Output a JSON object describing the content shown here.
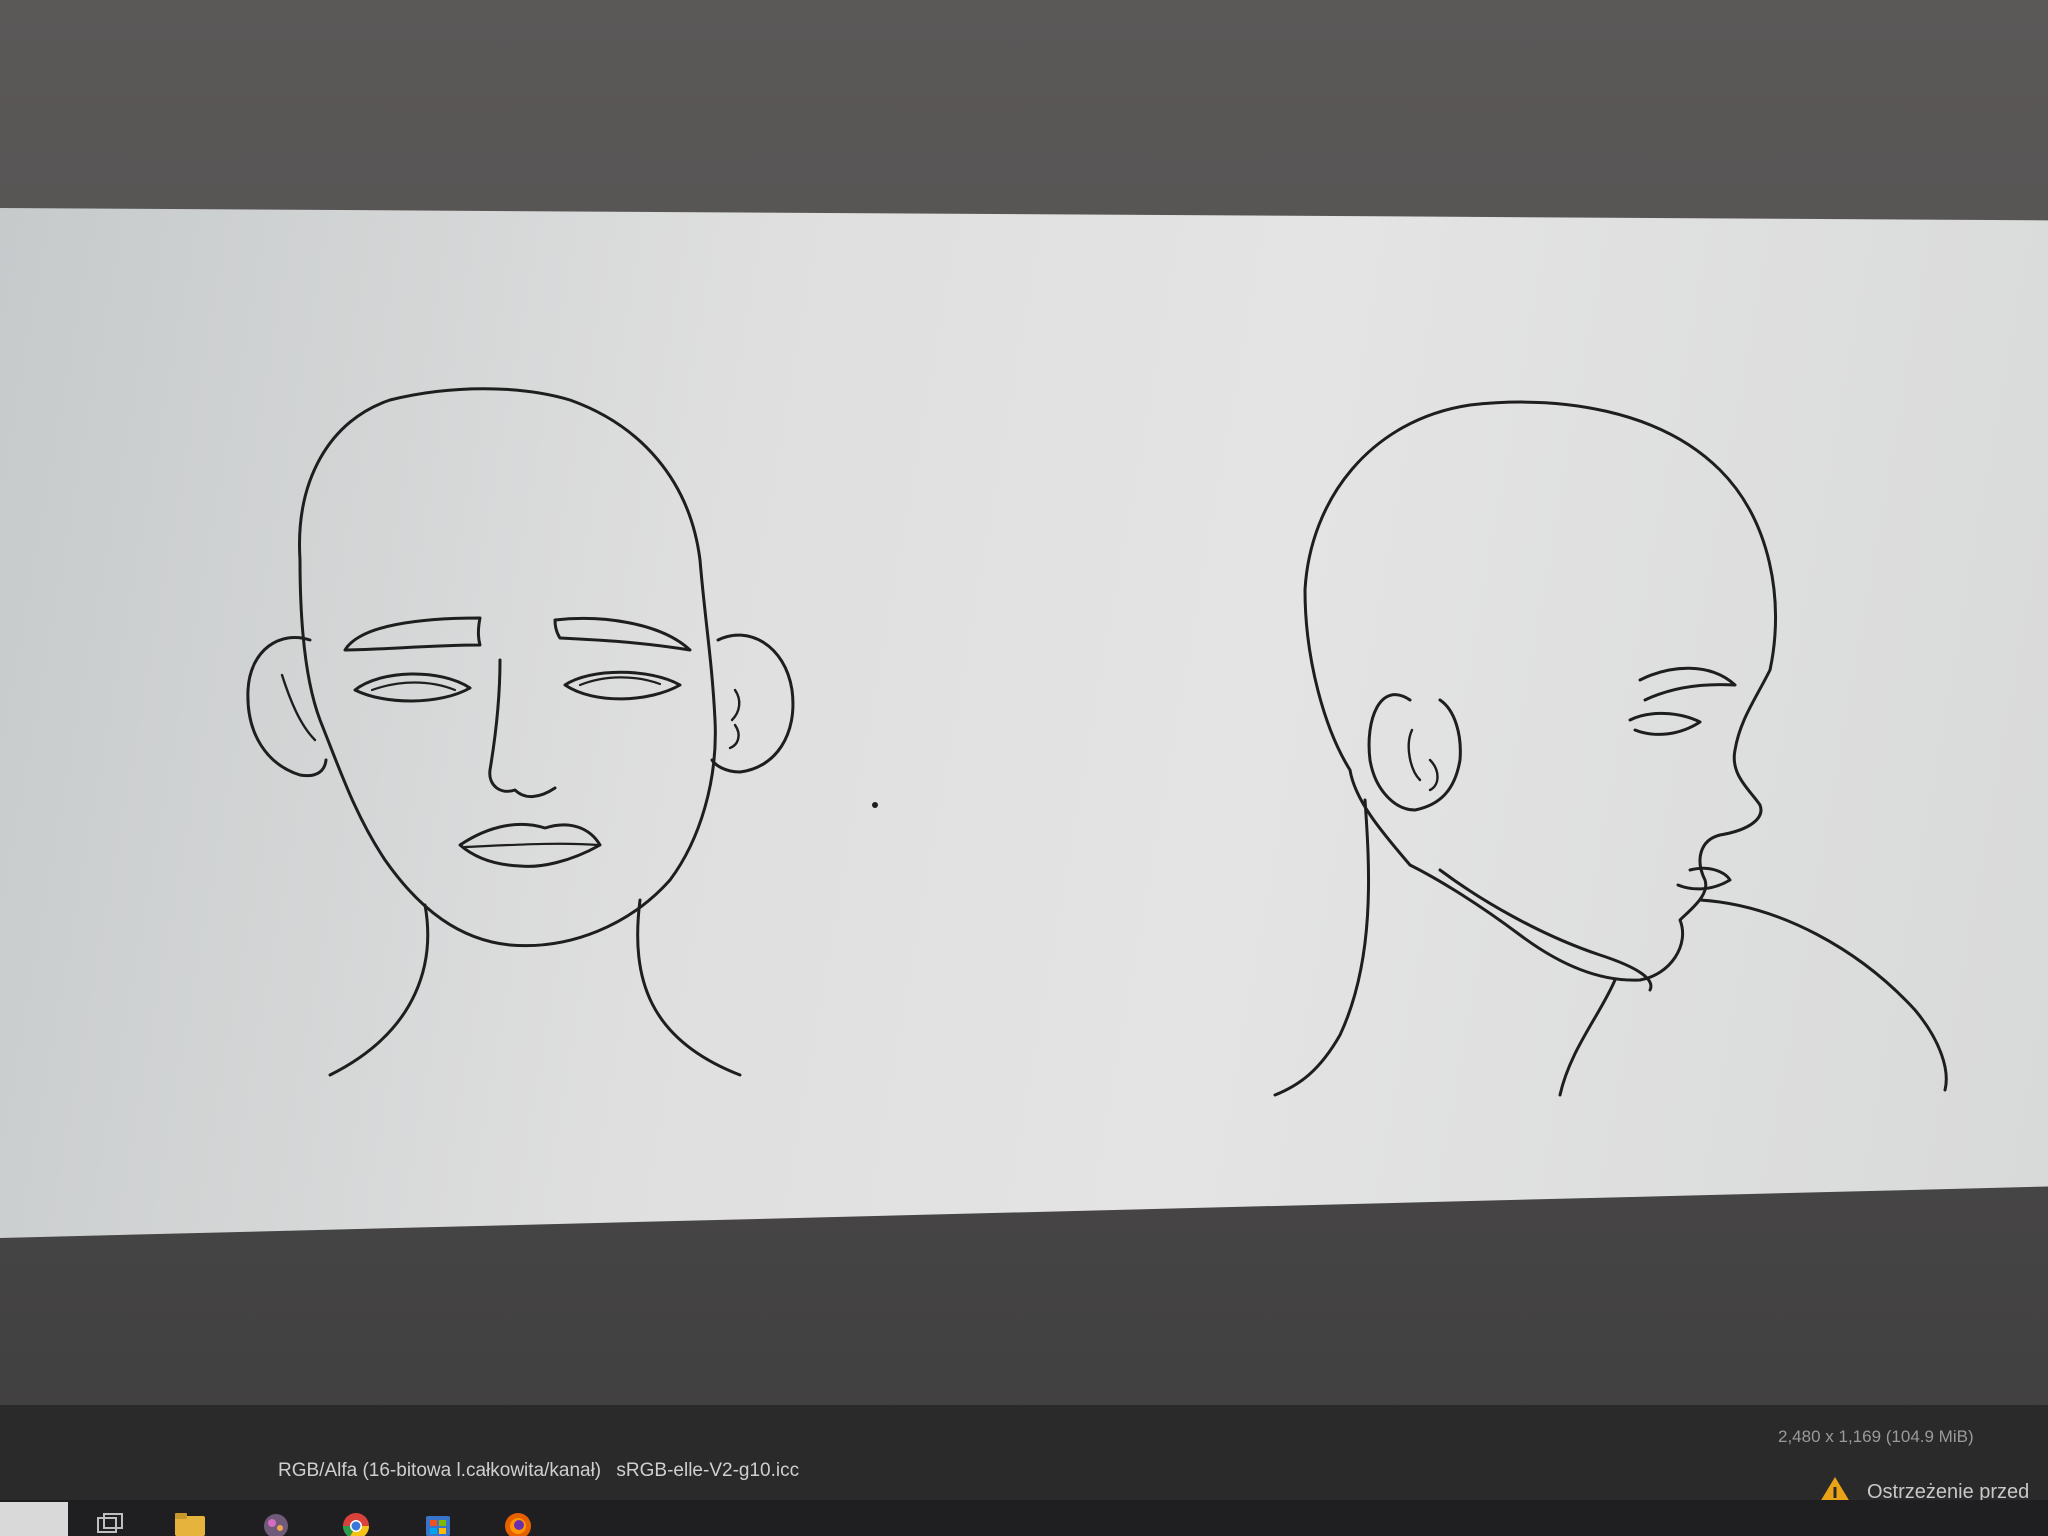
{
  "statusbar": {
    "mode": "RGB/Alfa (16-bitowa l.całkowita/kanał)",
    "profile": "sRGB-elle-V2-g10.icc",
    "dimensions": "2,480 x 1,169 (104.9 MiB)",
    "warning": "Ostrzeżenie przed"
  },
  "taskbar": {
    "icons": [
      "task-view-icon",
      "file-explorer-icon",
      "gimp-icon",
      "chrome-icon",
      "store-icon",
      "firefox-icon"
    ]
  },
  "colors": {
    "canvas": "#e0e0e0",
    "ink": "#1e1e1e",
    "workspace": "#4e4c4c",
    "statusbar": "#2b2a2a",
    "warning": "#e8a317"
  }
}
